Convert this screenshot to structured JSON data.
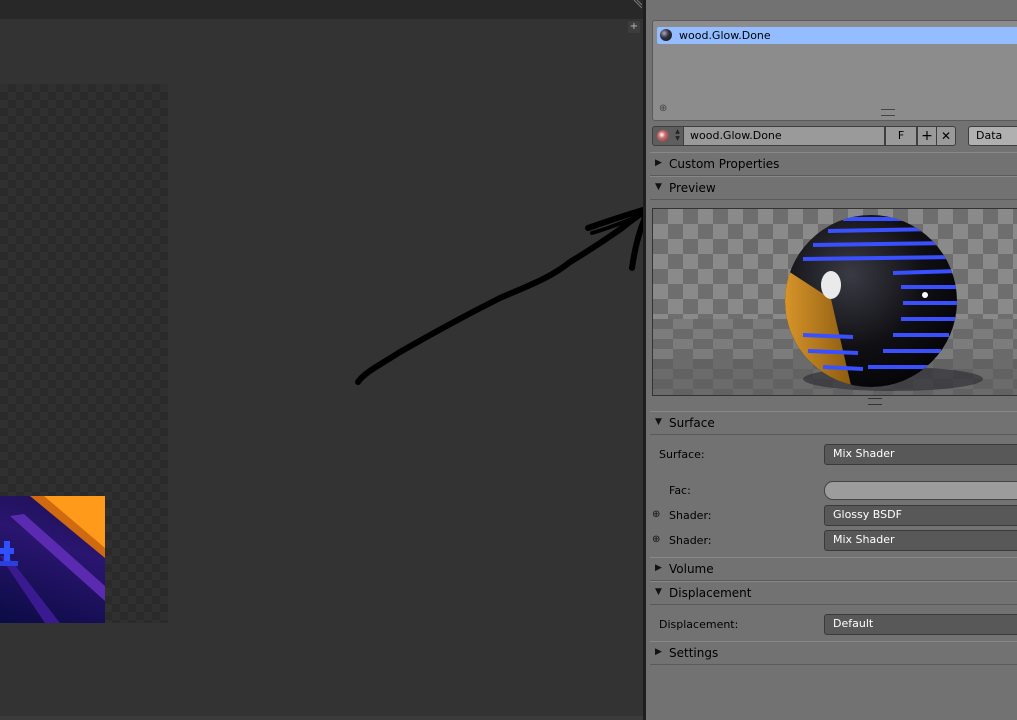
{
  "colors": {
    "selected_slot": "#94bdff",
    "panel_bg": "#727272",
    "viewport_bg": "#333333"
  },
  "material_slots": {
    "items": [
      {
        "name": "wood.Glow.Done",
        "icon": "material-ball-icon"
      }
    ]
  },
  "material_row": {
    "name_value": "wood.Glow.Done",
    "fake_user": "F",
    "new_symbol": "+",
    "unlink_symbol": "✕",
    "link_value": "Data"
  },
  "panels": {
    "custom_properties": {
      "label": "Custom Properties",
      "collapsed": true
    },
    "preview": {
      "label": "Preview",
      "collapsed": false
    },
    "surface": {
      "label": "Surface",
      "collapsed": false
    },
    "volume": {
      "label": "Volume",
      "collapsed": true
    },
    "displacement": {
      "label": "Displacement",
      "collapsed": false
    },
    "settings": {
      "label": "Settings",
      "collapsed": true
    }
  },
  "surface": {
    "surface_label": "Surface:",
    "surface_value": "Mix Shader",
    "fac_label": "Fac:",
    "shader1_label": "Shader:",
    "shader1_value": "Glossy BSDF",
    "shader2_label": "Shader:",
    "shader2_value": "Mix Shader"
  },
  "displacement": {
    "label": "Displacement:",
    "value": "Default"
  },
  "glyphs": {
    "expanded": "▼",
    "collapsed": "▶",
    "plus": "+",
    "socket": "⊕",
    "updown": "▲▼"
  }
}
